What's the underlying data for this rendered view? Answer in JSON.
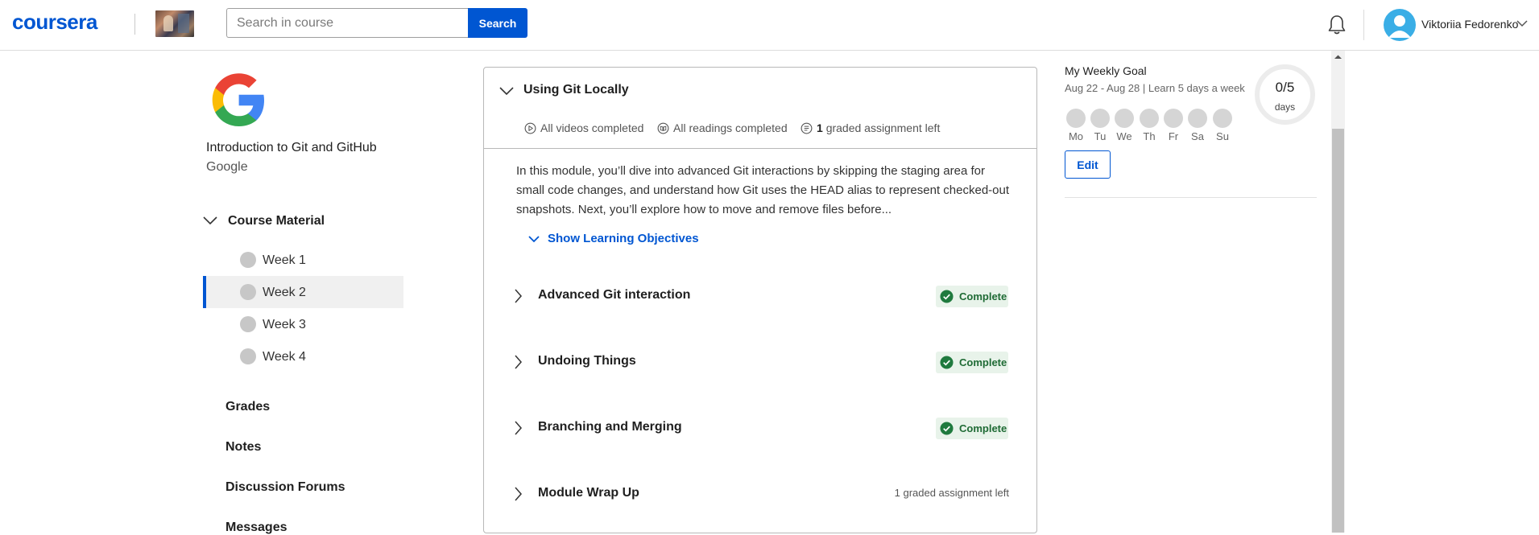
{
  "header": {
    "logo": "coursera",
    "search_placeholder": "Search in course",
    "search_button": "Search",
    "user_name": "Viktoriia Fedorenko",
    "icons": [
      "bell-icon",
      "avatar-icon",
      "chevron-down-icon"
    ]
  },
  "sidebar": {
    "course_title": "Introduction to Git and GitHub",
    "course_org": "Google",
    "course_material_label": "Course Material",
    "weeks": [
      {
        "label": "Week 1",
        "active": false
      },
      {
        "label": "Week 2",
        "active": true
      },
      {
        "label": "Week 3",
        "active": false
      },
      {
        "label": "Week 4",
        "active": false
      }
    ],
    "links": [
      "Grades",
      "Notes",
      "Discussion Forums",
      "Messages"
    ]
  },
  "module": {
    "title": "Using Git Locally",
    "stats": {
      "videos": "All videos completed",
      "readings": "All readings completed",
      "graded_count": "1",
      "graded_text": "graded assignment left"
    },
    "description": "In this module, you’ll dive into advanced Git interactions by skipping the staging area for small code changes, and understand how Git uses the HEAD alias to represent checked-out snapshots. Next, you’ll explore how to move and remove files before...",
    "learning_objectives": "Show Learning Objectives",
    "lessons": [
      {
        "title": "Advanced Git interaction",
        "status": "Complete"
      },
      {
        "title": "Undoing Things",
        "status": "Complete"
      },
      {
        "title": "Branching and Merging",
        "status": "Complete"
      },
      {
        "title": "Module Wrap Up",
        "status": "1 graded assignment left"
      }
    ],
    "colors": {
      "accent": "#0056d2",
      "complete_bg": "#e8f3ea",
      "complete_fg": "#1f6b35"
    }
  },
  "goal": {
    "title": "My Weekly Goal",
    "range": "Aug 22 - Aug 28 | Learn 5 days a week",
    "days": [
      "Mo",
      "Tu",
      "We",
      "Th",
      "Fr",
      "Sa",
      "Su"
    ],
    "count": "0/5",
    "unit": "days",
    "edit": "Edit"
  }
}
